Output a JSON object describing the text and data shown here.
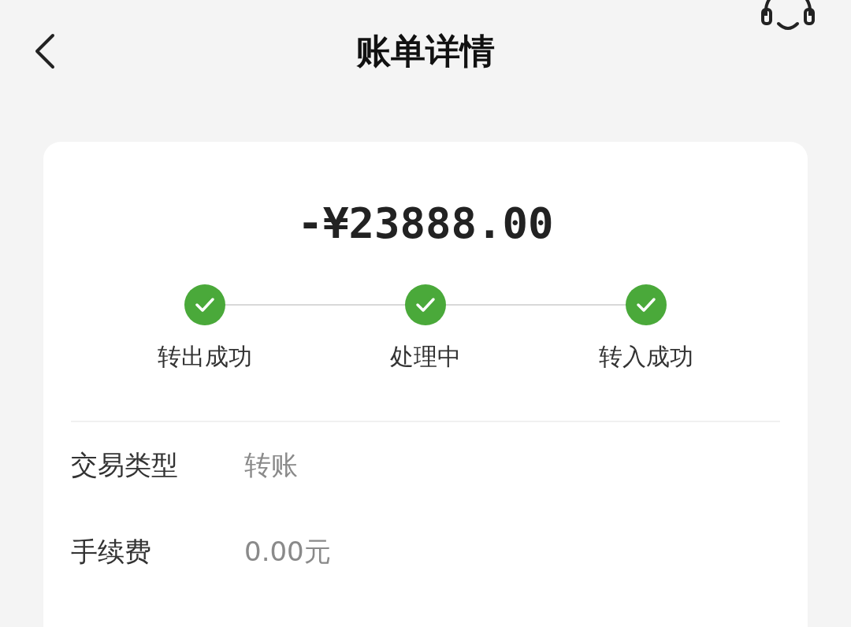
{
  "header": {
    "title": "账单详情"
  },
  "amount": "-¥23888.00",
  "steps": [
    {
      "label": "转出成功",
      "completed": true
    },
    {
      "label": "处理中",
      "completed": true
    },
    {
      "label": "转入成功",
      "completed": true
    }
  ],
  "details": [
    {
      "label": "交易类型",
      "value": "转账"
    },
    {
      "label": "手续费",
      "value": "0.00元"
    }
  ]
}
